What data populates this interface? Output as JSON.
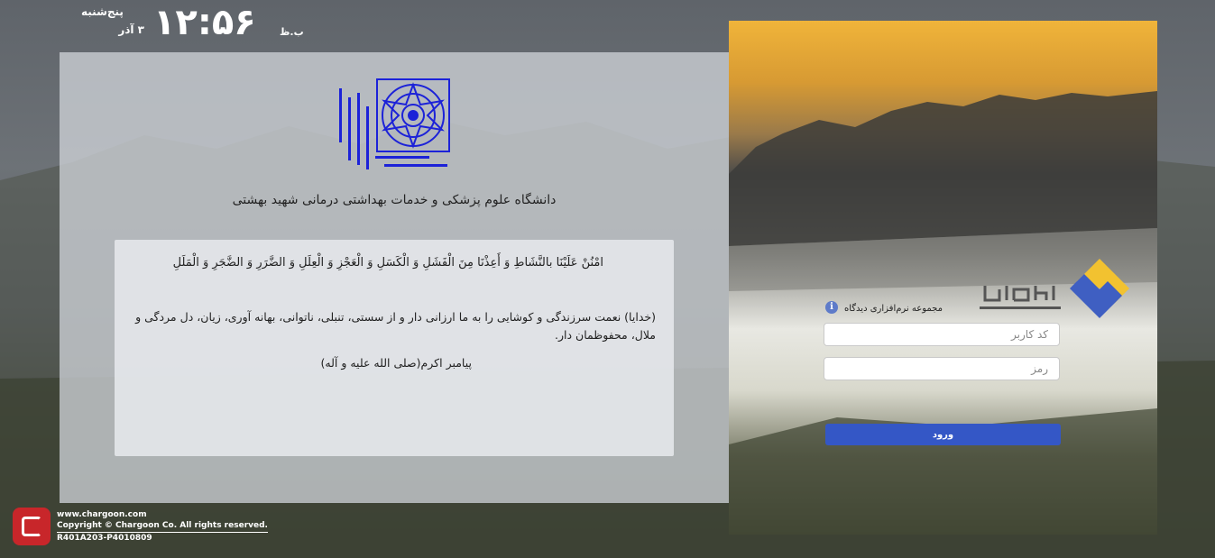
{
  "clock": {
    "time": "۱۲:۵۶",
    "ampm": "ب.ظ",
    "weekday": "پنج‌شنبه",
    "date": "۳ آذر"
  },
  "university": {
    "name": "دانشگاه علوم پزشکی و خدمات بهداشتی درمانی شهید بهشتی",
    "logo_color": "#1c22d8"
  },
  "quote": {
    "arabic": "امْنُنْ عَلَيْنَا بالنَّشَاطِ وَ أَعِذْنَا مِنَ الْفَشَلِ وَ الْكَسَلِ وَ الْعَجْزِ وَ الْعِلَلِ وَ الضَّرَرِ وَ الضَّجَرِ وَ الْمَلَلِ",
    "persian": "(خدایا) نعمت سرزندگی و کوشایی را به ما ارزانی دار و از سستی، تنبلی، ناتوانی، بهانه آوری، زیان، دل مردگی و ملال، محفوظمان دار.",
    "source": "پیامبر اکرم(صلی الله علیه و آله)"
  },
  "footer": {
    "website": "www.chargoon.com",
    "copyright": "Copyright © Chargoon Co. All rights reserved.",
    "version": "R401A203-P4010809"
  },
  "login": {
    "product_label": "مجموعه نرم‌افزاری دیدگاه",
    "info_symbol": "i",
    "username_placeholder": "کد کاربر",
    "password_placeholder": "رمز",
    "submit_label": "ورود",
    "accent_color": "#3457c6"
  }
}
